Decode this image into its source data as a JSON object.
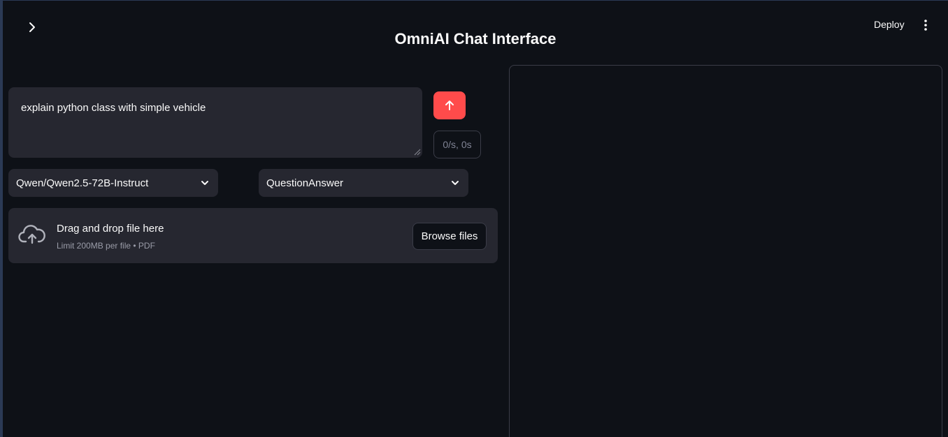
{
  "header": {
    "title": "OmniAI Chat Interface",
    "deploy_label": "Deploy",
    "sidebar_toggle_icon": "chevron-right-icon",
    "menu_icon": "vertical-dots-icon"
  },
  "prompt": {
    "value": "explain python class with simple vehicle"
  },
  "send_button": {
    "icon": "arrow-up-icon",
    "color": "#ff4b4b"
  },
  "stats": {
    "text": "0/s, 0s"
  },
  "selects": {
    "model": {
      "value": "Qwen/Qwen2.5-72B-Instruct"
    },
    "mode": {
      "value": "QuestionAnswer"
    }
  },
  "uploader": {
    "icon": "cloud-upload-icon",
    "title": "Drag and drop file here",
    "limit": "Limit 200MB per file • PDF",
    "browse_label": "Browse files"
  },
  "theme": {
    "background": "#0e1117",
    "surface": "#262730",
    "accent": "#ff4b4b"
  }
}
